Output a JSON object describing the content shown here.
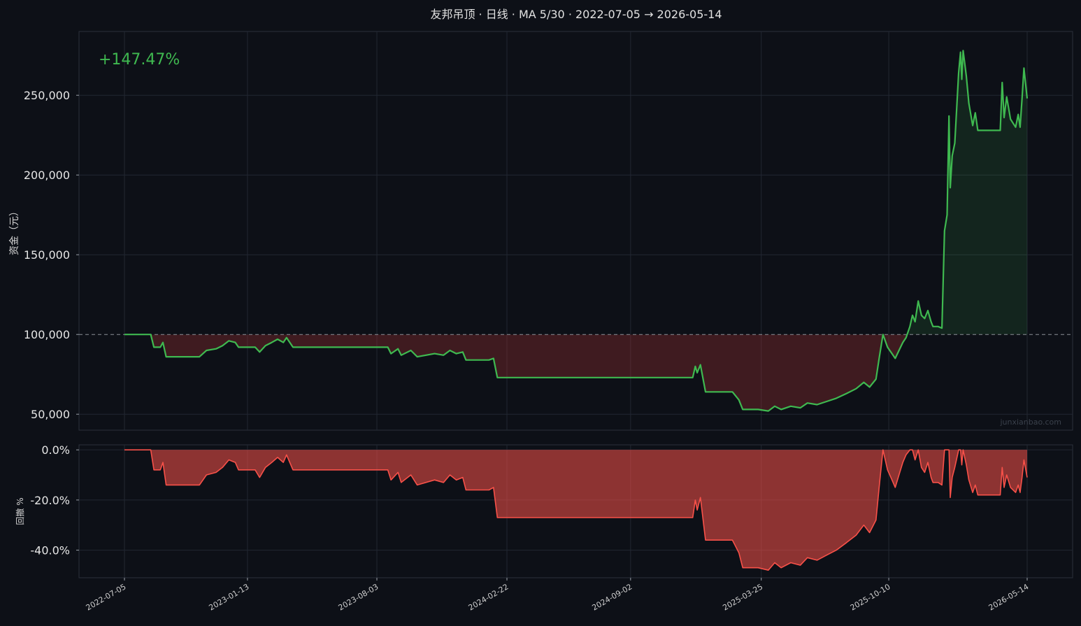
{
  "chart_data": [
    {
      "type": "line",
      "title": "友邦吊顶 · 日线 · MA 5/30 · 2022-07-05 → 2026-05-14",
      "ylabel": "资金（元）",
      "ylim": [
        40000,
        290000
      ],
      "yticks": [
        50000,
        100000,
        150000,
        200000,
        250000
      ],
      "ytick_labels": [
        "50,000",
        "100,000",
        "150,000",
        "200,000",
        "250,000"
      ],
      "baseline": 100000,
      "annotation": "+147.47%",
      "watermark": "junxianbao.com",
      "grid": true,
      "x_ticks": [
        "2022-07-05",
        "2023-01-13",
        "2023-08-03",
        "2024-02-22",
        "2024-09-02",
        "2025-03-25",
        "2025-10-10",
        "2026-05-14"
      ],
      "series": [
        {
          "color": "#3fb950",
          "points": [
            [
              "2022-07-05",
              100000
            ],
            [
              "2022-08-15",
              100000
            ],
            [
              "2022-08-20",
              92000
            ],
            [
              "2022-08-30",
              92000
            ],
            [
              "2022-09-03",
              95000
            ],
            [
              "2022-09-08",
              86000
            ],
            [
              "2022-10-30",
              86000
            ],
            [
              "2022-11-10",
              90000
            ],
            [
              "2022-11-25",
              91000
            ],
            [
              "2022-12-05",
              93000
            ],
            [
              "2022-12-15",
              96000
            ],
            [
              "2022-12-25",
              95000
            ],
            [
              "2022-12-30",
              92000
            ],
            [
              "2023-01-25",
              92000
            ],
            [
              "2023-02-01",
              89000
            ],
            [
              "2023-02-10",
              93000
            ],
            [
              "2023-02-20",
              95000
            ],
            [
              "2023-03-01",
              97000
            ],
            [
              "2023-03-10",
              95000
            ],
            [
              "2023-03-15",
              98000
            ],
            [
              "2023-03-25",
              92000
            ],
            [
              "2023-08-20",
              92000
            ],
            [
              "2023-08-25",
              88000
            ],
            [
              "2023-09-05",
              91000
            ],
            [
              "2023-09-10",
              87000
            ],
            [
              "2023-09-25",
              90000
            ],
            [
              "2023-10-05",
              86000
            ],
            [
              "2023-11-01",
              88000
            ],
            [
              "2023-11-15",
              87000
            ],
            [
              "2023-11-25",
              90000
            ],
            [
              "2023-12-05",
              88000
            ],
            [
              "2023-12-15",
              89000
            ],
            [
              "2023-12-20",
              84000
            ],
            [
              "2024-01-25",
              84000
            ],
            [
              "2024-02-01",
              85000
            ],
            [
              "2024-02-07",
              73000
            ],
            [
              "2024-12-08",
              73000
            ],
            [
              "2024-12-12",
              80000
            ],
            [
              "2024-12-15",
              76000
            ],
            [
              "2024-12-20",
              81000
            ],
            [
              "2024-12-28",
              64000
            ],
            [
              "2025-02-08",
              64000
            ],
            [
              "2025-02-18",
              59000
            ],
            [
              "2025-02-24",
              53000
            ],
            [
              "2025-03-20",
              53000
            ],
            [
              "2025-04-05",
              52000
            ],
            [
              "2025-04-15",
              55000
            ],
            [
              "2025-04-25",
              53000
            ],
            [
              "2025-05-10",
              55000
            ],
            [
              "2025-05-25",
              54000
            ],
            [
              "2025-06-05",
              57000
            ],
            [
              "2025-06-20",
              56000
            ],
            [
              "2025-07-05",
              58000
            ],
            [
              "2025-07-20",
              60000
            ],
            [
              "2025-08-05",
              63000
            ],
            [
              "2025-08-20",
              66000
            ],
            [
              "2025-09-01",
              70000
            ],
            [
              "2025-09-10",
              67000
            ],
            [
              "2025-09-20",
              72000
            ],
            [
              "2025-09-25",
              85000
            ],
            [
              "2025-10-01",
              100000
            ],
            [
              "2025-10-08",
              92000
            ],
            [
              "2025-10-15",
              88000
            ],
            [
              "2025-10-20",
              85000
            ],
            [
              "2025-10-26",
              90000
            ],
            [
              "2025-11-01",
              95000
            ],
            [
              "2025-11-06",
              98000
            ],
            [
              "2025-11-12",
              105000
            ],
            [
              "2025-11-16",
              112000
            ],
            [
              "2025-11-20",
              108000
            ],
            [
              "2025-11-25",
              121000
            ],
            [
              "2025-11-30",
              112000
            ],
            [
              "2025-12-05",
              110000
            ],
            [
              "2025-12-10",
              115000
            ],
            [
              "2025-12-15",
              108000
            ],
            [
              "2025-12-18",
              105000
            ],
            [
              "2025-12-26",
              105000
            ],
            [
              "2026-01-01",
              104000
            ],
            [
              "2026-01-05",
              165000
            ],
            [
              "2026-01-09",
              175000
            ],
            [
              "2026-01-12",
              237000
            ],
            [
              "2026-01-14",
              192000
            ],
            [
              "2026-01-17",
              212000
            ],
            [
              "2026-01-21",
              220000
            ],
            [
              "2026-01-27",
              264000
            ],
            [
              "2026-01-30",
              277000
            ],
            [
              "2026-02-01",
              260000
            ],
            [
              "2026-02-03",
              278000
            ],
            [
              "2026-02-08",
              262000
            ],
            [
              "2026-02-12",
              245000
            ],
            [
              "2026-02-18",
              231000
            ],
            [
              "2026-02-22",
              239000
            ],
            [
              "2026-02-26",
              228000
            ],
            [
              "2026-03-25",
              228000
            ],
            [
              "2026-04-02",
              228000
            ],
            [
              "2026-04-05",
              258000
            ],
            [
              "2026-04-08",
              236000
            ],
            [
              "2026-04-12",
              249000
            ],
            [
              "2026-04-18",
              235000
            ],
            [
              "2026-04-26",
              230000
            ],
            [
              "2026-04-30",
              238000
            ],
            [
              "2026-05-03",
              230000
            ],
            [
              "2026-05-06",
              248000
            ],
            [
              "2026-05-09",
              267000
            ],
            [
              "2026-05-14",
              248000
            ]
          ]
        }
      ]
    },
    {
      "type": "area",
      "ylabel": "回撤 %",
      "ylim": [
        -51,
        2
      ],
      "yticks": [
        0,
        -20,
        -40
      ],
      "ytick_labels": [
        "0.0%",
        "-20.0%",
        "-40.0%"
      ],
      "grid": true,
      "x_ticks": [
        "2022-07-05",
        "2023-01-13",
        "2023-08-03",
        "2024-02-22",
        "2024-09-02",
        "2025-03-25",
        "2025-10-10",
        "2026-05-14"
      ],
      "series": [
        {
          "color": "#f85149",
          "points": [
            [
              "2022-07-05",
              0
            ],
            [
              "2022-08-15",
              0
            ],
            [
              "2022-08-20",
              -8
            ],
            [
              "2022-08-30",
              -8
            ],
            [
              "2022-09-03",
              -5
            ],
            [
              "2022-09-08",
              -14
            ],
            [
              "2022-10-30",
              -14
            ],
            [
              "2022-11-10",
              -10
            ],
            [
              "2022-11-25",
              -9
            ],
            [
              "2022-12-05",
              -7
            ],
            [
              "2022-12-15",
              -4
            ],
            [
              "2022-12-25",
              -5
            ],
            [
              "2022-12-30",
              -8
            ],
            [
              "2023-01-25",
              -8
            ],
            [
              "2023-02-01",
              -11
            ],
            [
              "2023-02-10",
              -7
            ],
            [
              "2023-02-20",
              -5
            ],
            [
              "2023-03-01",
              -3
            ],
            [
              "2023-03-10",
              -5
            ],
            [
              "2023-03-15",
              -2
            ],
            [
              "2023-03-25",
              -8
            ],
            [
              "2023-08-20",
              -8
            ],
            [
              "2023-08-25",
              -12
            ],
            [
              "2023-09-05",
              -9
            ],
            [
              "2023-09-10",
              -13
            ],
            [
              "2023-09-25",
              -10
            ],
            [
              "2023-10-05",
              -14
            ],
            [
              "2023-11-01",
              -12
            ],
            [
              "2023-11-15",
              -13
            ],
            [
              "2023-11-25",
              -10
            ],
            [
              "2023-12-05",
              -12
            ],
            [
              "2023-12-15",
              -11
            ],
            [
              "2023-12-20",
              -16
            ],
            [
              "2024-01-25",
              -16
            ],
            [
              "2024-02-01",
              -15
            ],
            [
              "2024-02-07",
              -27
            ],
            [
              "2024-12-08",
              -27
            ],
            [
              "2024-12-12",
              -20
            ],
            [
              "2024-12-15",
              -24
            ],
            [
              "2024-12-20",
              -19
            ],
            [
              "2024-12-28",
              -36
            ],
            [
              "2025-02-08",
              -36
            ],
            [
              "2025-02-18",
              -41
            ],
            [
              "2025-02-24",
              -47
            ],
            [
              "2025-03-20",
              -47
            ],
            [
              "2025-04-05",
              -48
            ],
            [
              "2025-04-15",
              -45
            ],
            [
              "2025-04-25",
              -47
            ],
            [
              "2025-05-10",
              -45
            ],
            [
              "2025-05-25",
              -46
            ],
            [
              "2025-06-05",
              -43
            ],
            [
              "2025-06-20",
              -44
            ],
            [
              "2025-07-05",
              -42
            ],
            [
              "2025-07-20",
              -40
            ],
            [
              "2025-08-05",
              -37
            ],
            [
              "2025-08-20",
              -34
            ],
            [
              "2025-09-01",
              -30
            ],
            [
              "2025-09-10",
              -33
            ],
            [
              "2025-09-20",
              -28
            ],
            [
              "2025-09-25",
              -15
            ],
            [
              "2025-10-01",
              0
            ],
            [
              "2025-10-08",
              -8
            ],
            [
              "2025-10-15",
              -12
            ],
            [
              "2025-10-20",
              -15
            ],
            [
              "2025-10-26",
              -10
            ],
            [
              "2025-11-01",
              -5
            ],
            [
              "2025-11-06",
              -2
            ],
            [
              "2025-11-12",
              0
            ],
            [
              "2025-11-16",
              0
            ],
            [
              "2025-11-20",
              -4
            ],
            [
              "2025-11-25",
              0
            ],
            [
              "2025-11-30",
              -7
            ],
            [
              "2025-12-05",
              -9
            ],
            [
              "2025-12-10",
              -5
            ],
            [
              "2025-12-15",
              -11
            ],
            [
              "2025-12-18",
              -13
            ],
            [
              "2025-12-26",
              -13
            ],
            [
              "2026-01-01",
              -14
            ],
            [
              "2026-01-05",
              0
            ],
            [
              "2026-01-09",
              0
            ],
            [
              "2026-01-12",
              0
            ],
            [
              "2026-01-14",
              -19
            ],
            [
              "2026-01-17",
              -11
            ],
            [
              "2026-01-21",
              -7
            ],
            [
              "2026-01-27",
              0
            ],
            [
              "2026-01-30",
              0
            ],
            [
              "2026-02-01",
              -6
            ],
            [
              "2026-02-03",
              0
            ],
            [
              "2026-02-08",
              -6
            ],
            [
              "2026-02-12",
              -12
            ],
            [
              "2026-02-18",
              -17
            ],
            [
              "2026-02-22",
              -14
            ],
            [
              "2026-02-26",
              -18
            ],
            [
              "2026-03-25",
              -18
            ],
            [
              "2026-04-02",
              -18
            ],
            [
              "2026-04-05",
              -7
            ],
            [
              "2026-04-08",
              -15
            ],
            [
              "2026-04-12",
              -10
            ],
            [
              "2026-04-18",
              -15
            ],
            [
              "2026-04-26",
              -17
            ],
            [
              "2026-04-30",
              -14
            ],
            [
              "2026-05-03",
              -17
            ],
            [
              "2026-05-06",
              -11
            ],
            [
              "2026-05-09",
              -4
            ],
            [
              "2026-05-14",
              -11
            ]
          ]
        }
      ]
    }
  ]
}
